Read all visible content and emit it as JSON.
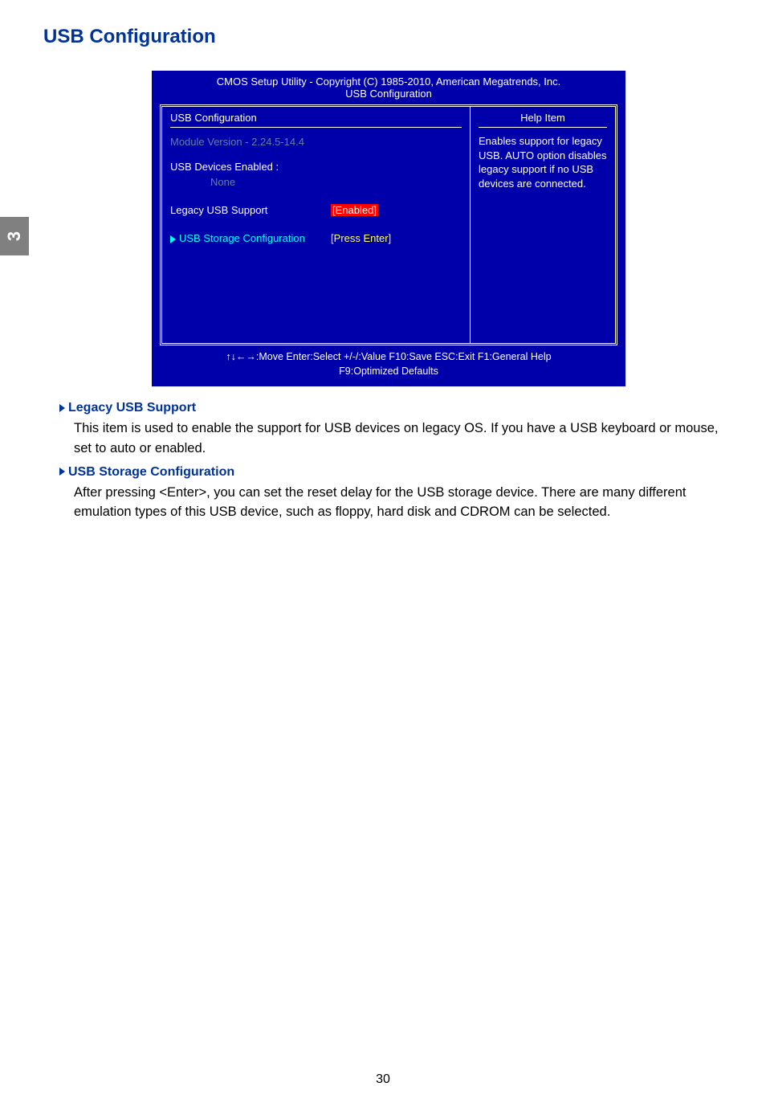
{
  "side_tab": "3",
  "page_title": "USB Configuration",
  "bios": {
    "title_line1": "CMOS Setup Utility - Copyright (C) 1985-2010, American Megatrends, Inc.",
    "title_line2": "USB Configuration",
    "left_header": "USB Configuration",
    "module_version": "Module Version  -  2.24.5-14.4",
    "usb_devices_label": "USB Devices Enabled :",
    "usb_devices_value": "None",
    "legacy_label": "Legacy USB Support",
    "legacy_value": "[Enabled]",
    "storage_label": "USB Storage Configuration",
    "storage_value": "[Press Enter]",
    "help_title": "Help Item",
    "help_text": "Enables support for legacy USB.  AUTO option disables legacy support if no USB devices are connected.",
    "footer_line1": "↑↓←→:Move   Enter:Select     +/-/:Value     F10:Save       ESC:Exit     F1:General Help",
    "footer_line2": "F9:Optimized Defaults"
  },
  "sections": {
    "legacy_heading": "Legacy USB Support",
    "legacy_text": "This item is used to enable the support for USB devices on legacy OS. If you have a USB keyboard or mouse, set to auto or enabled.",
    "storage_heading": "USB Storage Configuration",
    "storage_text": "After pressing <Enter>, you can set the reset delay for the USB storage device. There are many different emulation types of this USB device, such as floppy, hard disk and CDROM can be selected."
  },
  "page_number": "30"
}
